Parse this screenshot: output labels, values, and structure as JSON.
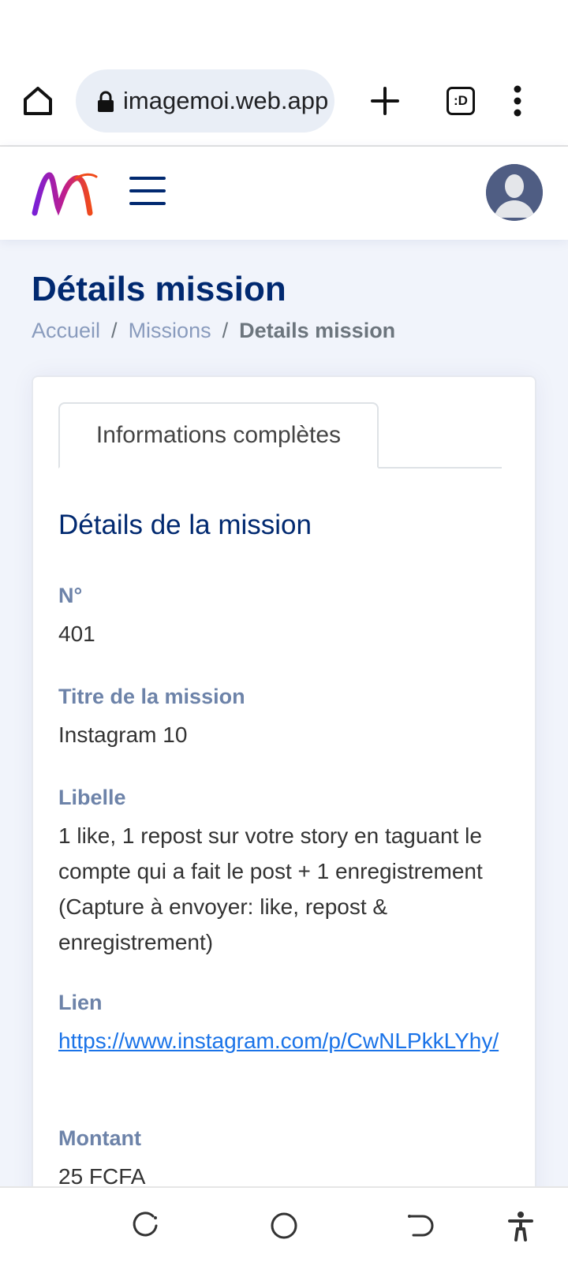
{
  "browser": {
    "url": "imagemoi.web.app",
    "tabs_label": ":D"
  },
  "colors": {
    "brand_navy": "#012970",
    "label_blue": "#6d83a9",
    "link_blue": "#1a73e8",
    "page_bg": "#f1f4fb"
  },
  "app_header": {
    "logo_icon": "imagemoi-logo",
    "menu_icon": "hamburger-icon",
    "avatar_icon": "user-avatar"
  },
  "page": {
    "title": "Détails mission",
    "breadcrumb": {
      "home": "Accueil",
      "separator": "/",
      "missions": "Missions",
      "current": "Details mission"
    }
  },
  "card": {
    "tab_label": "Informations complètes",
    "section_title": "Détails de la mission",
    "fields": {
      "number_label": "N°",
      "number_value": "401",
      "title_label": "Titre de la mission",
      "title_value": "Instagram 10",
      "libelle_label": "Libelle",
      "libelle_value": "1 like, 1 repost sur votre story en taguant le compte qui a fait le post + 1 enregistrement (Capture à envoyer: like, repost & enregistrement)",
      "link_label": "Lien",
      "link_value": "https://www.instagram.com/p/CwNLPkkLYhy/",
      "amount_label": "Montant",
      "amount_value": "25 FCFA"
    }
  },
  "android_nav": {
    "recents_icon": "recents-icon",
    "home_icon": "home-circle-icon",
    "back_icon": "back-icon",
    "accessibility_icon": "accessibility-icon"
  }
}
